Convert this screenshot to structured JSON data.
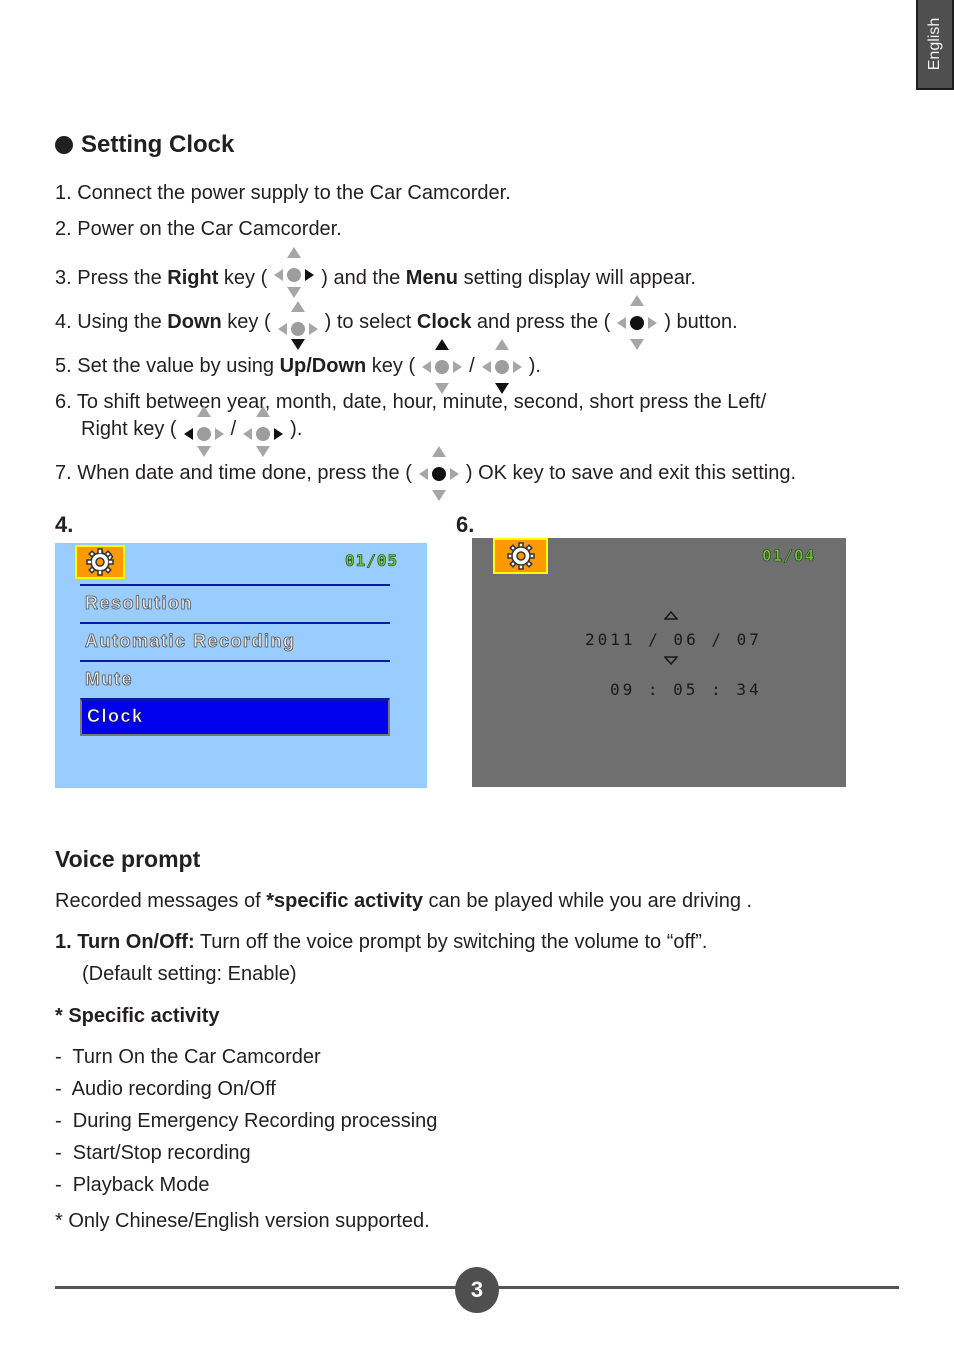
{
  "language_tab": "English",
  "setting_clock": {
    "title": "Setting Clock",
    "steps": {
      "s1": "1. Connect the power supply to the Car Camcorder.",
      "s2": "2. Power on the Car Camcorder.",
      "s3": {
        "a": "3. Press the ",
        "b": "Right",
        "c": " key (",
        "d": ") and the ",
        "e": "Menu",
        "f": " setting display will appear."
      },
      "s4": {
        "a": "4. Using the ",
        "b": "Down",
        "c": " key (",
        "d": ") to select ",
        "e": "Clock",
        "f": " and press the (",
        "g": ") button."
      },
      "s5": {
        "a": "5. Set the value by using ",
        "b": "Up/Down",
        "c": " key (",
        "d": "/",
        "e": ")."
      },
      "s6": {
        "a": "6. To shift between year, month, date, hour, minute, second, short press the Left/",
        "b": "Right key (",
        "c": "/",
        "d": ")."
      },
      "s7": {
        "a": "7. When date and time done, press the (",
        "b": ") OK key to save and exit this setting."
      }
    }
  },
  "figure4": {
    "label": "4.",
    "icon": "gear-icon",
    "counter": "01/05",
    "menu_items": [
      "Resolution",
      "Automatic Recording",
      "Mute",
      "Clock"
    ],
    "selected": "Clock",
    "colors": {
      "background": "#99ccff",
      "selected": "#0000ee",
      "icon_bg": "#ff9900"
    }
  },
  "figure6": {
    "label": "6.",
    "icon": "gear-icon",
    "counter": "01/04",
    "date": "2011 / 06 / 07",
    "time": "09 : 05 : 34",
    "colors": {
      "background": "#6f6f6f"
    }
  },
  "voice_prompt": {
    "title": "Voice prompt",
    "intro": {
      "a": "Recorded messages of ",
      "b": "*specific activity",
      "c": " can be played while you are driving ."
    },
    "item1": {
      "num": "1.",
      "label": "Turn On/Off:",
      "text": " Turn off the voice prompt by switching the volume to “off”.",
      "note": "(Default setting: Enable)"
    },
    "specific_title": "* Specific activity",
    "activities": [
      "Turn On the Car Camcorder",
      "Audio recording On/Off",
      "During Emergency Recording processing",
      "Start/Stop recording",
      "Playback Mode"
    ],
    "footnote": "* Only Chinese/English version supported."
  },
  "page_number": "3"
}
